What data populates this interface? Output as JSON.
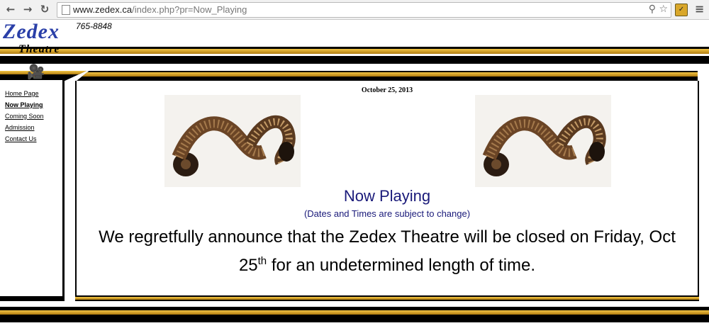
{
  "browser": {
    "url_host": "www.zedex.ca",
    "url_path": "/index.php?pr=Now_Playing",
    "icons": [
      "back-arrow-icon",
      "forward-arrow-icon",
      "reload-icon",
      "page-icon",
      "zoom-icon",
      "star-icon",
      "extension-icon",
      "menu-icon"
    ]
  },
  "header": {
    "logo_main": "Zedex",
    "logo_sub": "Theatre",
    "phone": "765-8848"
  },
  "sidebar": {
    "items": [
      {
        "label": "Home Page",
        "active": false
      },
      {
        "label": "Now Playing",
        "active": true
      },
      {
        "label": "Coming Soon",
        "active": false
      },
      {
        "label": "Admission",
        "active": false
      },
      {
        "label": "Contact Us",
        "active": false
      }
    ]
  },
  "content": {
    "date": "October 25, 2013",
    "title": "Now Playing",
    "subtitle": "(Dates and Times are subject to change)",
    "announcement_line1": "We regretfully announce that the Zedex Theatre will be closed on Friday, Oct",
    "announcement_num": "25",
    "announcement_sup": "th",
    "announcement_line2": " for an undetermined length of time."
  },
  "colors": {
    "gold": "#d9a72a",
    "band": "#000000",
    "title_blue": "#1a1a7a",
    "logo_blue": "#2a3fa8"
  }
}
